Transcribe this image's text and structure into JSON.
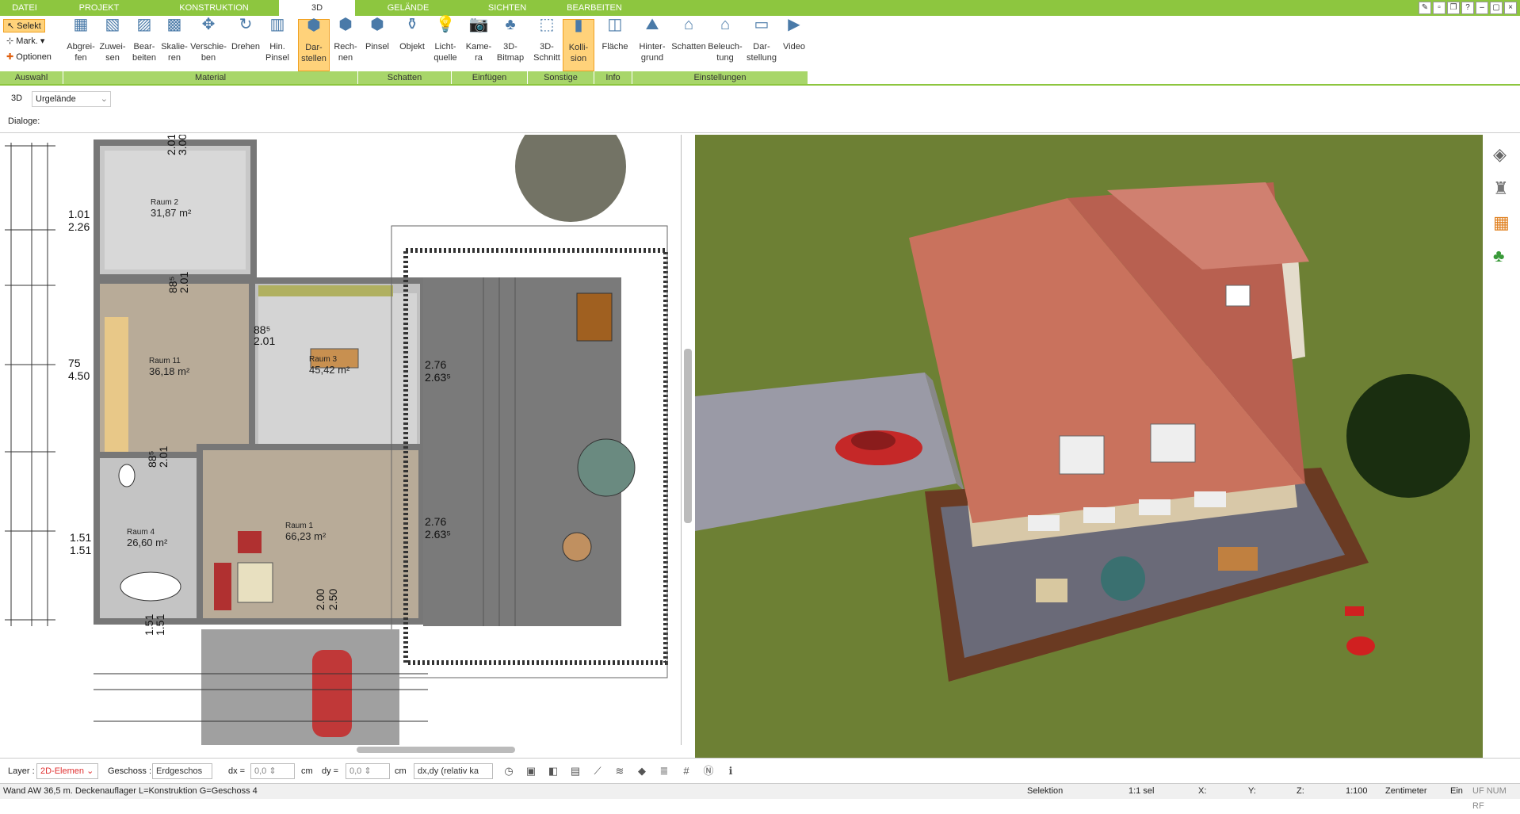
{
  "menu": {
    "tabs": [
      "DATEI",
      "PROJEKT",
      "KONSTRUKTION",
      "3D",
      "GELÄNDE",
      "SICHTEN",
      "BEARBEITEN"
    ],
    "active": "3D"
  },
  "ribbon": {
    "auswahl": {
      "selekt": "Selekt",
      "mark": "Mark.",
      "optionen": "Optionen"
    },
    "buttons": [
      {
        "l1": "Abgrei-",
        "l2": "fen"
      },
      {
        "l1": "Zuwei-",
        "l2": "sen"
      },
      {
        "l1": "Bear-",
        "l2": "beiten"
      },
      {
        "l1": "Skalie-",
        "l2": "ren"
      },
      {
        "l1": "Verschie-",
        "l2": "ben"
      },
      {
        "l1": "Drehen",
        "l2": ""
      },
      {
        "l1": "Hin.",
        "l2": "Pinsel"
      },
      {
        "l1": "Dar-",
        "l2": "stellen"
      },
      {
        "l1": "Rech-",
        "l2": "nen"
      },
      {
        "l1": "Pinsel",
        "l2": ""
      },
      {
        "l1": "Objekt",
        "l2": ""
      },
      {
        "l1": "Licht-",
        "l2": "quelle"
      },
      {
        "l1": "Kame-",
        "l2": "ra"
      },
      {
        "l1": "3D-",
        "l2": "Bitmap"
      },
      {
        "l1": "3D-",
        "l2": "Schnitt"
      },
      {
        "l1": "Kolli-",
        "l2": "sion"
      },
      {
        "l1": "Fläche",
        "l2": ""
      },
      {
        "l1": "Hinter-",
        "l2": "grund"
      },
      {
        "l1": "Schatten",
        "l2": ""
      },
      {
        "l1": "Beleuch-",
        "l2": "tung"
      },
      {
        "l1": "Dar-",
        "l2": "stellung"
      },
      {
        "l1": "Video",
        "l2": ""
      }
    ],
    "groups": [
      "Auswahl",
      "Material",
      "Schatten",
      "Einfügen",
      "Sonstige",
      "Info",
      "Einstellungen"
    ]
  },
  "viewbar": {
    "mode": "3D",
    "selector": "Urgelände"
  },
  "dialogbar": {
    "label": "Dialoge:"
  },
  "rooms": [
    {
      "name": "Raum 2",
      "area": "31,87 m²"
    },
    {
      "name": "Raum 11",
      "area": "36,18 m²"
    },
    {
      "name": "Raum 3",
      "area": "45,42 m²"
    },
    {
      "name": "Raum 1",
      "area": "66,23 m²"
    },
    {
      "name": "Raum 4",
      "area": "26,60 m²"
    }
  ],
  "dims": [
    "1.01",
    "2.26",
    "75",
    "4.50",
    "1.51",
    "1.51",
    "2.01",
    "3.00",
    "88⁵",
    "2.01",
    "88⁵",
    "2.01",
    "2.76",
    "2.63⁵",
    "2.76",
    "2.63⁵",
    "88⁵",
    "2.01",
    "2.00",
    "2.50",
    "1.51",
    "1.51"
  ],
  "bottombar": {
    "layer_label": "Layer :",
    "layer_value": "2D-Elemen",
    "geschoss_label": "Geschoss :",
    "geschoss_value": "Erdgeschos",
    "dx_label": "dx =",
    "dx_value": "0,0",
    "dx_unit": "cm",
    "dy_label": "dy =",
    "dy_value": "0,0",
    "dy_unit": "cm",
    "mode": "dx,dy (relativ ka"
  },
  "status": {
    "text": "Wand AW 36,5 m. Deckenauflager L=Konstruktion G=Geschoss 4",
    "selektion": "Selektion",
    "sel": "1:1 sel",
    "x": "X:",
    "y": "Y:",
    "z": "Z:",
    "scale": "1:100",
    "unit": "Zentimeter",
    "ein": "Ein",
    "flags": "UF NUM RF"
  },
  "colors": {
    "accent": "#8dc63f",
    "selected": "#ffd27a",
    "grass": "#6d8034",
    "roof": "#c9725d"
  }
}
